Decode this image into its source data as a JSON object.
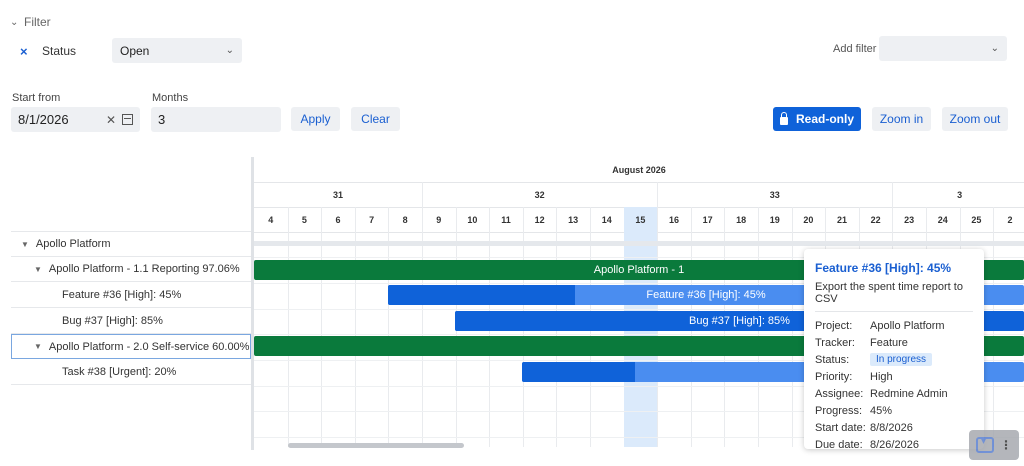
{
  "filter": {
    "section_label": "Filter",
    "status_label": "Status",
    "status_value": "Open",
    "add_filter_label": "Add filter",
    "add_filter_value": ""
  },
  "controls": {
    "start_from_label": "Start from",
    "start_from_value": "8/1/2026",
    "months_label": "Months",
    "months_value": "3",
    "apply_label": "Apply",
    "clear_label": "Clear",
    "readonly_label": "Read-only",
    "zoom_in_label": "Zoom in",
    "zoom_out_label": "Zoom out"
  },
  "tree": [
    {
      "label": "Apollo Platform"
    },
    {
      "label": "Apollo Platform - 1.1 Reporting 97.06%"
    },
    {
      "label": "Feature #36 [High]: 45%"
    },
    {
      "label": "Bug #37 [High]: 85%"
    },
    {
      "label": "Apollo Platform - 2.0 Self-service 60.00%"
    },
    {
      "label": "Task #38 [Urgent]: 20%"
    }
  ],
  "gantt": {
    "month": "August 2026",
    "weeks": [
      "31",
      "32",
      "33",
      "3"
    ],
    "days": [
      "4",
      "5",
      "6",
      "7",
      "8",
      "9",
      "10",
      "11",
      "12",
      "13",
      "14",
      "15",
      "16",
      "17",
      "18",
      "19",
      "20",
      "21",
      "22",
      "23",
      "24",
      "25",
      "2"
    ],
    "today_day": "15",
    "bars": [
      {
        "label": "Apollo Platform - 1.1 Reporting 97.06%",
        "visible_label": "Apollo Platform - 1",
        "color": "#0a7a3c",
        "done_fraction": 0.9706
      },
      {
        "label": "Feature #36 [High]: 45%",
        "visible_label": "Feature #36 [High]: 45%",
        "color": "#4a8df0",
        "done_color": "#0f62d9",
        "done_fraction": 0.45
      },
      {
        "label": "Bug #37 [High]: 85%",
        "visible_label": "Bug #37 [High]: 85%",
        "color": "#4a8df0",
        "done_color": "#0f62d9",
        "done_fraction": 0.85
      },
      {
        "label": "Apollo Platform - 2.0 Self-service 60.00%",
        "visible_label": "",
        "color": "#0a7a3c",
        "done_fraction": 0.6
      },
      {
        "label": "Task #38 [Urgent]: 20%",
        "visible_label": "",
        "color": "#4a8df0",
        "done_color": "#0f62d9",
        "done_fraction": 0.2
      }
    ]
  },
  "tooltip": {
    "title": "Feature #36 [High]: 45%",
    "subtitle": "Export the spent time report to CSV",
    "rows": [
      {
        "key": "Project:",
        "value": "Apollo Platform"
      },
      {
        "key": "Tracker:",
        "value": "Feature"
      },
      {
        "key": "Status:",
        "value": "In progress"
      },
      {
        "key": "Priority:",
        "value": "High"
      },
      {
        "key": "Assignee:",
        "value": "Redmine Admin"
      },
      {
        "key": "Progress:",
        "value": "45%"
      },
      {
        "key": "Start date:",
        "value": "8/8/2026"
      },
      {
        "key": "Due date:",
        "value": "8/26/2026"
      }
    ]
  },
  "colors": {
    "accent": "#0f62d9",
    "version_bar": "#0a7a3c",
    "today": "#dbeafb"
  }
}
